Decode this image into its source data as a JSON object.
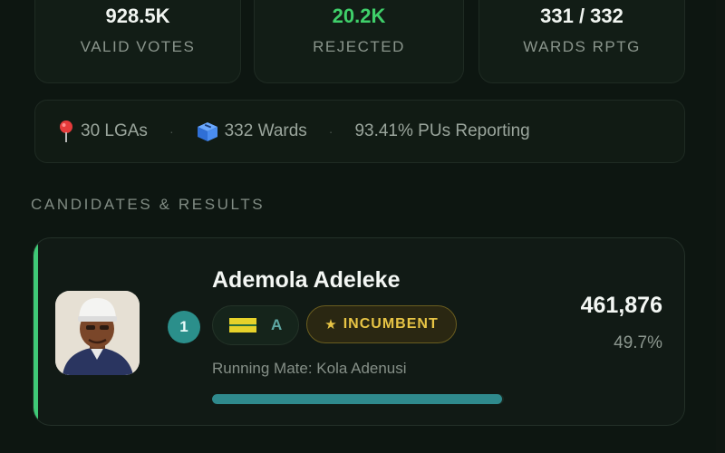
{
  "stats": [
    {
      "value": "928.5K",
      "label": "VALID VOTES"
    },
    {
      "value": "20.2K",
      "label": "REJECTED"
    },
    {
      "value": "331 / 332",
      "label": "WARDS RPTG"
    }
  ],
  "info": {
    "lgas": "30 LGAs",
    "wards": "332 Wards",
    "reporting": "93.41% PUs Reporting",
    "pin_icon": "map-pin-icon",
    "box_icon": "ballot-box-icon"
  },
  "section_title": "CANDIDATES & RESULTS",
  "candidate": {
    "rank": "1",
    "name": "Ademola Adeleke",
    "party_code": "A",
    "incumbent_label": "INCUMBENT",
    "running_mate": "Running Mate: Kola Adenusi",
    "votes": "461,876",
    "percent": "49.7%",
    "vote_share": 0.497,
    "accent_color": "#3fc977",
    "bar_color": "#2f8a8d"
  },
  "colors": {
    "rejected_value": "#3fcf6a",
    "incumbent_gold": "#e7c445",
    "rank_teal": "#2b8f8b"
  }
}
